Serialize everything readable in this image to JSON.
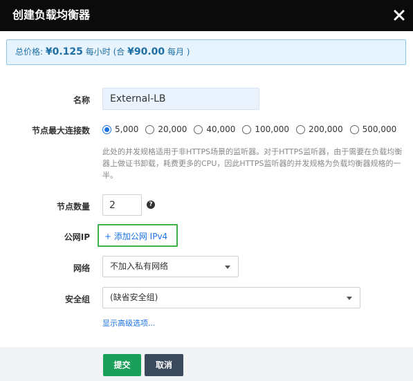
{
  "dialog": {
    "title": "创建负载均衡器"
  },
  "price": {
    "label": "总价格:",
    "hourly": "¥0.125",
    "hourly_unit": "每小时",
    "monthly_prefix": "(合",
    "monthly": "¥90.00",
    "monthly_suffix": "每月 )"
  },
  "form": {
    "name": {
      "label": "名称",
      "value": "External-LB"
    },
    "max_connections": {
      "label": "节点最大连接数",
      "options": [
        "5,000",
        "20,000",
        "40,000",
        "100,000",
        "200,000",
        "500,000"
      ],
      "selected": "5,000",
      "hint": "此处的并发规格适用于非HTTPS场景的监听器。对于HTTPS监听器，由于需要在负载均衡器上做证书卸载，耗费更多的CPU，因此HTTPS监听器的并发规格为负载均衡器规格的一半。"
    },
    "node_count": {
      "label": "节点数量",
      "value": "2",
      "help_icon": "question-circle-icon"
    },
    "public_ip": {
      "label": "公网IP",
      "add_link": "+ 添加公网 IPv4",
      "highlight_color": "#3cb44b"
    },
    "network": {
      "label": "网络",
      "selected": "不加入私有网络"
    },
    "security_group": {
      "label": "安全组",
      "selected": "(缺省安全组)"
    },
    "advanced_link": "显示高级选项..."
  },
  "footer": {
    "submit_label": "提交",
    "cancel_label": "取消"
  },
  "colors": {
    "header_bg": "#0b0b0b",
    "price_text": "#1d6fa5",
    "price_bg": "#e8f4fd",
    "link": "#1a73e8",
    "submit": "#1aa05b",
    "cancel": "#3a4a5c"
  }
}
